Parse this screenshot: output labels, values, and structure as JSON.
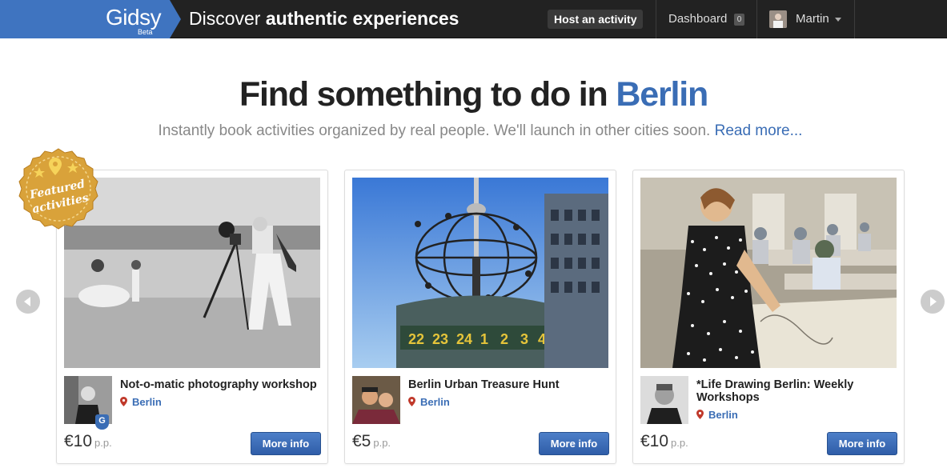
{
  "header": {
    "logo": "Gidsy",
    "logo_badge": "Beta",
    "tagline_prefix": "Discover",
    "tagline_bold": "authentic experiences",
    "host_button": "Host an activity",
    "dashboard_label": "Dashboard",
    "dashboard_count": "0",
    "user_name": "Martin"
  },
  "hero": {
    "headline_prefix": "Find something to do in",
    "headline_city": "Berlin",
    "subline": "Instantly book activities organized by real people. We'll launch in other cities soon.",
    "read_more": "Read more..."
  },
  "badge": {
    "line1": "Featured",
    "line2": "activities"
  },
  "activities": [
    {
      "title": "Not-o-matic photography workshop",
      "location": "Berlin",
      "price": "€10",
      "price_unit": "p.p.",
      "button": "More info",
      "host_badge": "G"
    },
    {
      "title": "Berlin Urban Treasure Hunt",
      "location": "Berlin",
      "price": "€5",
      "price_unit": "p.p.",
      "button": "More info"
    },
    {
      "title": "*Life Drawing Berlin: Weekly Workshops",
      "location": "Berlin",
      "price": "€10",
      "price_unit": "p.p.",
      "button": "More info"
    }
  ],
  "colors": {
    "brand_blue": "#3a6db5",
    "topbar": "#222222",
    "badge_gold": "#d9a23a"
  },
  "icons": [
    "pin-icon",
    "chevron-left-icon",
    "chevron-right-icon",
    "caret-down-icon",
    "star-icon"
  ]
}
